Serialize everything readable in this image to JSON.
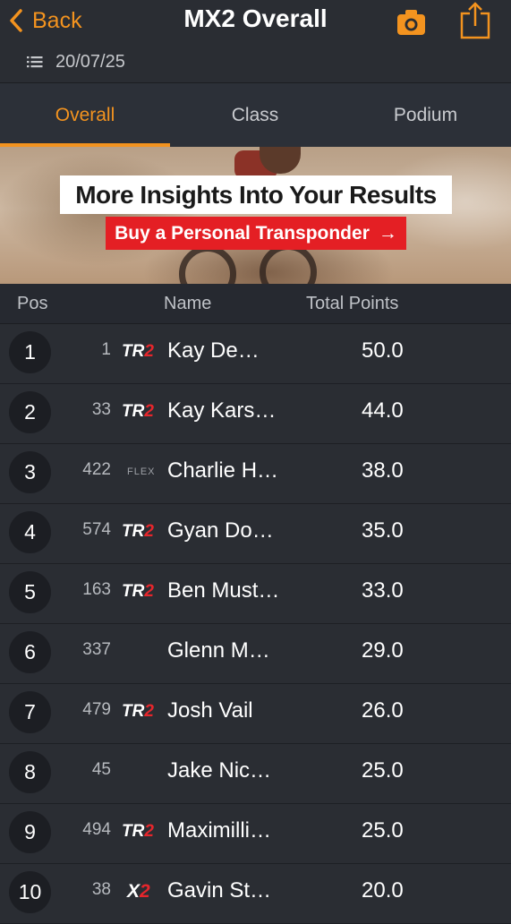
{
  "header": {
    "back_label": "Back",
    "title": "MX2 Overall",
    "date": "20/07/25"
  },
  "tabs": [
    {
      "label": "Overall",
      "active": true
    },
    {
      "label": "Class",
      "active": false
    },
    {
      "label": "Podium",
      "active": false
    }
  ],
  "banner": {
    "headline": "More Insights Into Your Results",
    "cta": "Buy a Personal Transponder",
    "cta_arrow": "→"
  },
  "columns": {
    "pos": "Pos",
    "name": "Name",
    "points": "Total Points"
  },
  "colors": {
    "accent": "#f3931f",
    "background": "#2a2d33",
    "banner_red": "#e41f24"
  },
  "rows": [
    {
      "pos": "1",
      "bib": "1",
      "tag": "TR2",
      "name": "Kay De…",
      "points": "50.0"
    },
    {
      "pos": "2",
      "bib": "33",
      "tag": "TR2",
      "name": "Kay Kars…",
      "points": "44.0"
    },
    {
      "pos": "3",
      "bib": "422",
      "tag": "FLEX",
      "name": "Charlie H…",
      "points": "38.0"
    },
    {
      "pos": "4",
      "bib": "574",
      "tag": "TR2",
      "name": "Gyan Do…",
      "points": "35.0"
    },
    {
      "pos": "5",
      "bib": "163",
      "tag": "TR2",
      "name": "Ben Must…",
      "points": "33.0"
    },
    {
      "pos": "6",
      "bib": "337",
      "tag": "",
      "name": "Glenn M…",
      "points": "29.0"
    },
    {
      "pos": "7",
      "bib": "479",
      "tag": "TR2",
      "name": "Josh Vail",
      "points": "26.0"
    },
    {
      "pos": "8",
      "bib": "45",
      "tag": "",
      "name": "Jake Nic…",
      "points": "25.0"
    },
    {
      "pos": "9",
      "bib": "494",
      "tag": "TR2",
      "name": "Maximilli…",
      "points": "25.0"
    },
    {
      "pos": "10",
      "bib": "38",
      "tag": "X2",
      "name": "Gavin St…",
      "points": "20.0"
    }
  ]
}
